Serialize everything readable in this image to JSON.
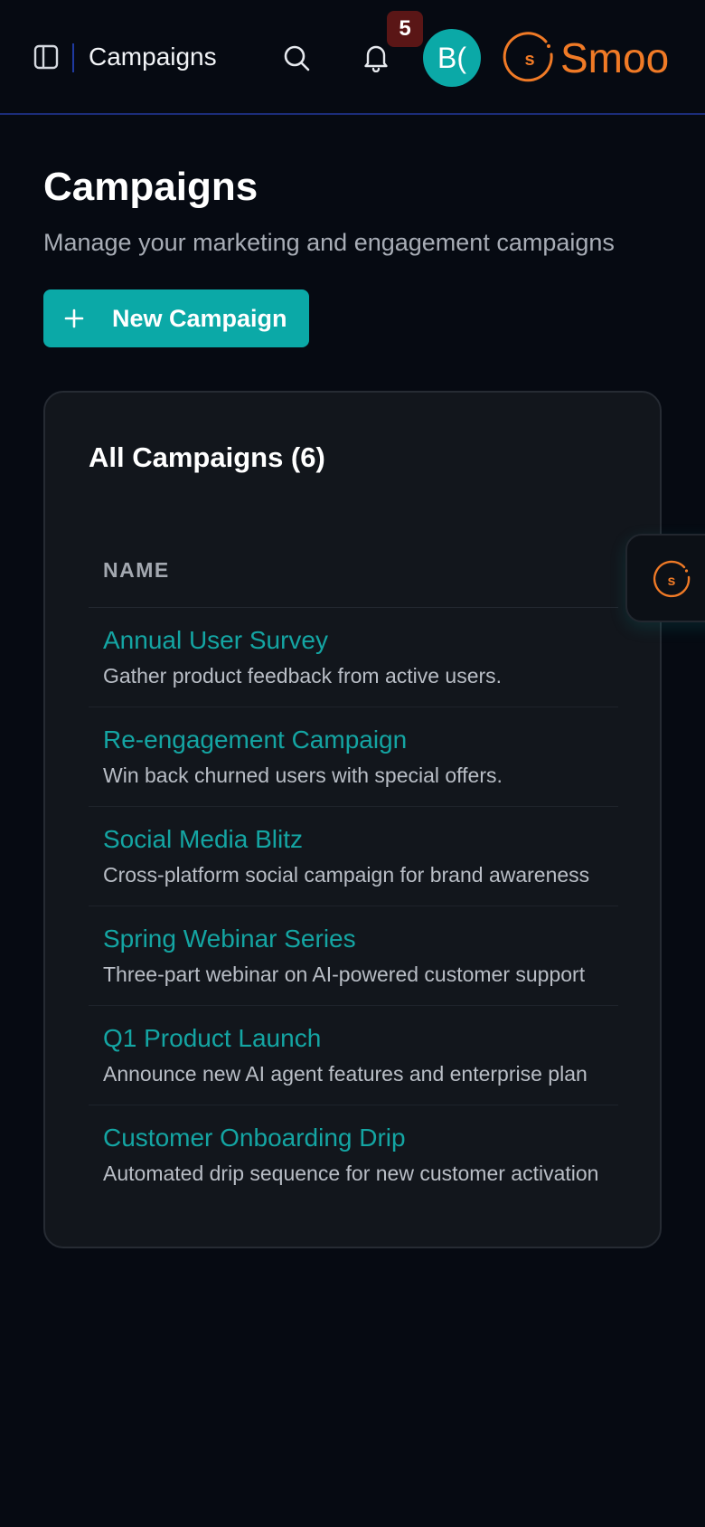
{
  "topbar": {
    "title": "Campaigns",
    "notification_count": "5",
    "avatar_initials": "B(",
    "brand_name": "Smoo",
    "brand_logo_letter": "s"
  },
  "page": {
    "title": "Campaigns",
    "subtitle": "Manage your marketing and engagement campaigns",
    "new_button_label": "New Campaign"
  },
  "campaigns_card": {
    "title": "All Campaigns (6)",
    "column_header": "NAME",
    "rows": [
      {
        "name": "Annual User Survey",
        "description": "Gather product feedback from active users."
      },
      {
        "name": "Re-engagement Campaign",
        "description": "Win back churned users with special offers."
      },
      {
        "name": "Social Media Blitz",
        "description": "Cross-platform social campaign for brand awareness"
      },
      {
        "name": "Spring Webinar Series",
        "description": "Three-part webinar on AI-powered customer support"
      },
      {
        "name": "Q1 Product Launch",
        "description": "Announce new AI agent features and enterprise plan"
      },
      {
        "name": "Customer Onboarding Drip",
        "description": "Automated drip sequence for new customer activation"
      }
    ]
  },
  "floating_widget": {
    "logo_letter": "s"
  },
  "colors": {
    "background": "#060a12",
    "accent_teal": "#0ba9a7",
    "brand_orange": "#f07a26",
    "badge_red": "#5a1616"
  },
  "icons": [
    "sidebar-toggle-icon",
    "search-icon",
    "bell-icon",
    "plus-icon",
    "brand-logo-icon"
  ]
}
